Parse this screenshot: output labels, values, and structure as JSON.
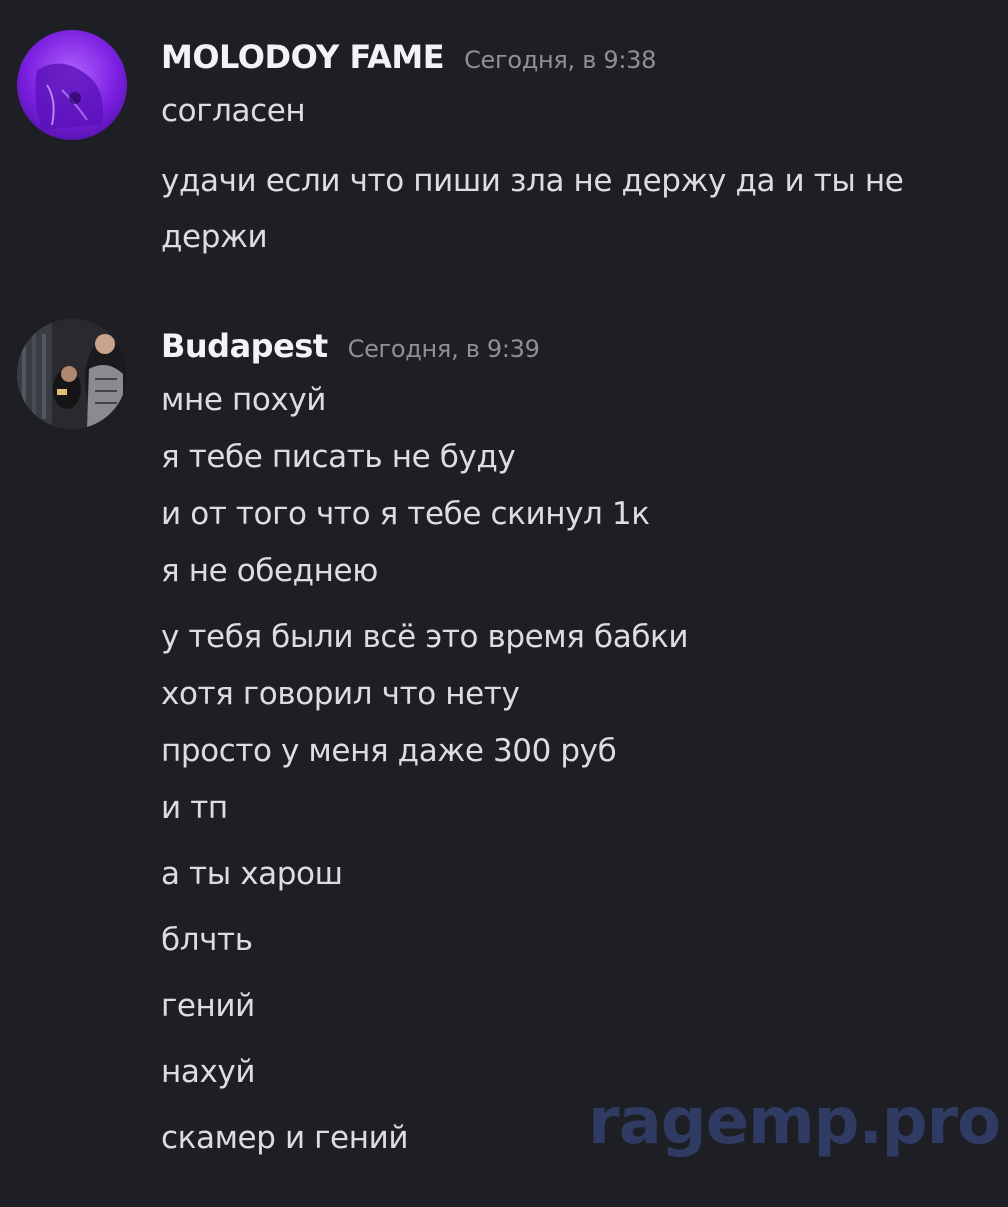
{
  "messages": [
    {
      "username": "MOLODOY FAME",
      "timestamp": "Сегодня, в 9:38",
      "lines": [
        "согласен",
        "удачи если что пиши зла не держу да и ты не",
        "держи"
      ]
    },
    {
      "username": "Budapest",
      "timestamp": "Сегодня, в 9:39",
      "lines": [
        "мне похуй",
        "я тебе писать не буду",
        "и от того что я тебе скинул 1к",
        "я не обеднею",
        "у тебя были всё это время бабки",
        "хотя говорил что нету",
        "просто у меня даже 300 руб",
        "и тп",
        "а ты харош",
        "блчть",
        "гений",
        "нахуй",
        "скамер и гений"
      ]
    }
  ],
  "watermark": "ragemp.pro",
  "colors": {
    "background": "#1e1f24",
    "username": "#f2f3f5",
    "text": "#dcdde1",
    "timestamp": "#8e9096",
    "watermark": "#2f3b63",
    "avatar1": "#7a1fe0"
  }
}
